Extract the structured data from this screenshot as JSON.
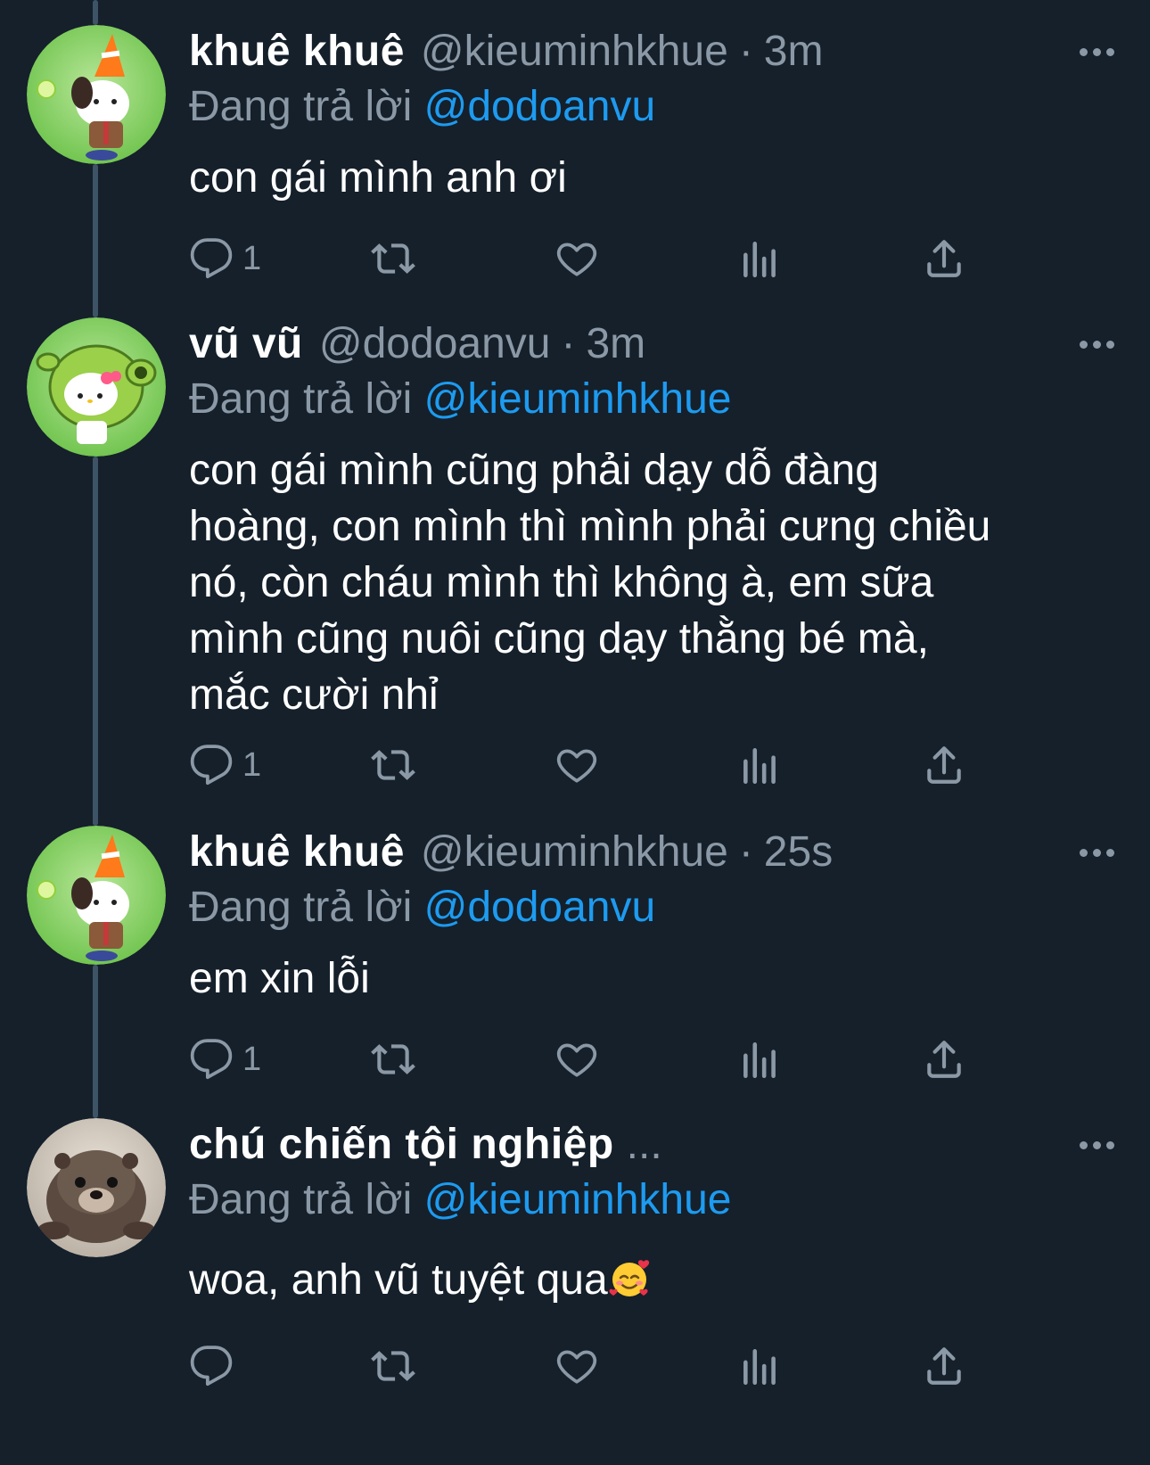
{
  "theme": {
    "background": "#15202b",
    "text_primary": "#ffffff",
    "text_secondary": "#8b98a5",
    "accent": "#1d9bf0",
    "thread_line": "#3d5466"
  },
  "tweets": [
    {
      "display_name": "khuê khuê",
      "handle": "@kieuminhkhue",
      "separator": "·",
      "time": "3m",
      "reply_prefix": "Đang trả lời",
      "reply_to": "@dodoanvu",
      "text": "con gái mình anh ơi",
      "reply_count": "1",
      "avatar": "pochacco-cone-avatar"
    },
    {
      "display_name": "vũ vũ",
      "handle": "@dodoanvu",
      "separator": "·",
      "time": "3m",
      "reply_prefix": "Đang trả lời",
      "reply_to": "@kieuminhkhue",
      "text": "con gái mình cũng phải dạy dỗ đàng\nhoàng, con mình thì mình phải cưng chiều\nnó, còn cháu mình thì không à, em sữa\nmình cũng nuôi cũng dạy thằng bé mà,\nmắc cười nhỉ",
      "reply_count": "1",
      "avatar": "hello-kitty-peashooter-avatar"
    },
    {
      "display_name": "khuê khuê",
      "handle": "@kieuminhkhue",
      "separator": "·",
      "time": "25s",
      "reply_prefix": "Đang trả lời",
      "reply_to": "@dodoanvu",
      "text": "em xin lỗi",
      "reply_count": "1",
      "avatar": "pochacco-cone-avatar"
    },
    {
      "display_name": "chú chiến tội nghiệp",
      "truncation": "...",
      "reply_prefix": "Đang trả lời",
      "reply_to": "@kieuminhkhue",
      "text": "woa, anh vũ tuyệt qua",
      "emoji": "smiling-face-with-hearts",
      "reply_count": "",
      "avatar": "otter-avatar"
    }
  ],
  "icons": {
    "reply": "reply-icon",
    "retweet": "retweet-icon",
    "like": "heart-icon",
    "views": "views-icon",
    "share": "share-icon",
    "more": "more-icon"
  }
}
